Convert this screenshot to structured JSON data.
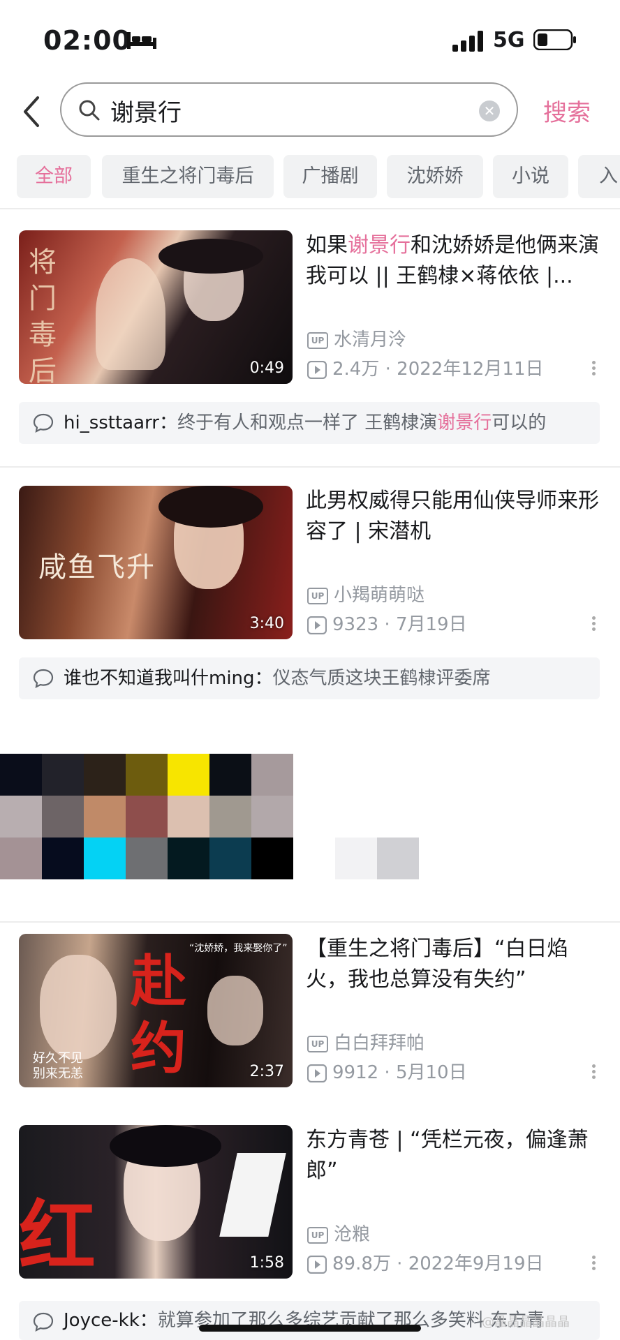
{
  "status_bar": {
    "time": "02:00",
    "network": "5G"
  },
  "search": {
    "query": "谢景行",
    "submit_label": "搜索"
  },
  "filter_tabs": [
    {
      "label": "全部",
      "active": true
    },
    {
      "label": "重生之将门毒后",
      "active": false
    },
    {
      "label": "广播剧",
      "active": false
    },
    {
      "label": "沈娇娇",
      "active": false
    },
    {
      "label": "小说",
      "active": false
    },
    {
      "label": "入",
      "active": false
    }
  ],
  "videos": [
    {
      "title_before": "如果",
      "title_highlight": "谢景行",
      "title_after": "和沈娇娇是他俩来演我可以 || 王鹤棣×蒋依依 |...",
      "thumb_text": "将门毒后",
      "duration": "0:49",
      "uploader": "水清月泠",
      "views": "2.4万",
      "date": "2022年12月11日",
      "comment": {
        "user": "hi_ssttaarr：",
        "text_before": "终于有人和观点一样了 王鹤棣演",
        "highlight": "谢景行",
        "text_after": "可以的"
      }
    },
    {
      "title_before": "此男权威得只能用仙侠导师来形容了 | 宋潜机",
      "title_highlight": "",
      "title_after": "",
      "thumb_text": "咸鱼飞升",
      "duration": "3:40",
      "uploader": "小羯萌萌哒",
      "views": "9323",
      "date": "7月19日",
      "comment": {
        "user": "谁也不知道我叫什ming：",
        "text_before": "仪态气质这块王鹤棣评委席",
        "highlight": "",
        "text_after": ""
      }
    },
    {
      "title_before": "【重生之将门毒后】“白日焰火，我也总算没有失约”",
      "title_highlight": "",
      "title_after": "",
      "thumb_text": "赴约",
      "thumb_caption_top": "“沈娇娇，我来娶你了”",
      "thumb_caption_bottom": "好久不见\n别来无恙",
      "duration": "2:37",
      "uploader": "白白拜拜帕",
      "views": "9912",
      "date": "5月10日"
    },
    {
      "title_before": "东方青苍 | “凭栏元夜，偏逢萧郎”",
      "title_highlight": "",
      "title_after": "",
      "thumb_text": "红",
      "duration": "1:58",
      "uploader": "沧粮",
      "views": "89.8万",
      "date": "2022年9月19日",
      "comment": {
        "user": "Joyce-kk：",
        "text_before": "就算参加了那么多综艺贡献了那么多笑料 东方青",
        "highlight": "",
        "text_after": ""
      }
    }
  ],
  "watermark": "@晶晶晶晶晶晶",
  "colors": {
    "accent": "#e5709b",
    "muted": "#9499a0",
    "tab_bg": "#f1f2f3"
  }
}
